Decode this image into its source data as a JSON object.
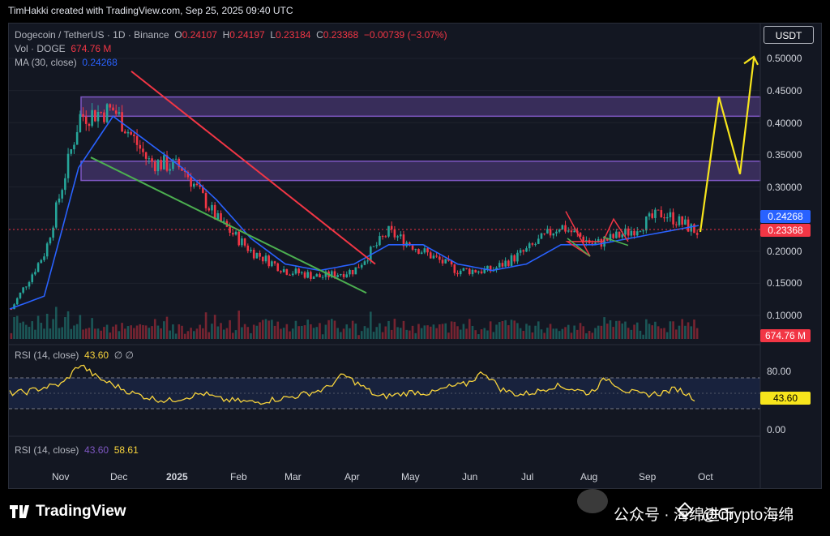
{
  "credit": "TimHakki created with TradingView.com, Sep 25, 2025 09:40 UTC",
  "legend": {
    "symbol": "Dogecoin / TetherUS · 1D · Binance",
    "open_label": "O",
    "open": "0.24107",
    "high_label": "H",
    "high": "0.24197",
    "low_label": "L",
    "low": "0.23184",
    "close_label": "C",
    "close": "0.23368",
    "change": "−0.00739 (−3.07%)",
    "vol_label": "Vol · DOGE",
    "vol": "674.76 M",
    "ma_label": "MA (30, close)",
    "ma": "0.24268",
    "rsi1_label": "RSI (14, close)",
    "rsi1": "43.60",
    "rsi1_extra": "∅  ∅",
    "rsi2_label": "RSI (14, close)",
    "rsi2_a": "43.60",
    "rsi2_b": "58.61"
  },
  "currency": "USDT",
  "price_axis": [
    "0.50000",
    "0.45000",
    "0.40000",
    "0.35000",
    "0.30000",
    "0.20000",
    "0.15000",
    "0.10000"
  ],
  "rsi_axis": [
    "80.00",
    "0.00"
  ],
  "tags": {
    "ma": "0.24268",
    "close": "0.23368",
    "volume": "674.76 M",
    "rsi": "43.60"
  },
  "x_axis": [
    "Nov",
    "Dec",
    "2025",
    "Feb",
    "Mar",
    "Apr",
    "May",
    "Jun",
    "Jul",
    "Aug",
    "Sep",
    "Oct"
  ],
  "brand": "TradingView",
  "watermark": {
    "wechat": "公众号 · 海绵进币",
    "handle": "@Crypto海绵"
  },
  "colors": {
    "up": "#26a69a",
    "down": "#f23645",
    "ma": "#2962ff",
    "rsi": "#f7d33c",
    "zone": "#7e57c2",
    "projection": "#f7e51c",
    "support": "#4caf50"
  },
  "chart_data": {
    "type": "line",
    "title": "Dogecoin / TetherUS · 1D · Binance",
    "ylim": [
      0.1,
      0.5
    ],
    "x": [
      "Nov",
      "Dec",
      "2025",
      "Feb",
      "Mar",
      "Apr",
      "May",
      "Jun",
      "Jul",
      "Aug",
      "Sep",
      "Oct"
    ],
    "series": [
      {
        "name": "Dogecoin / TetherUS",
        "values": [
          0.11,
          0.2,
          0.41,
          0.42,
          0.34,
          0.33,
          0.25,
          0.2,
          0.17,
          0.16,
          0.17,
          0.23,
          0.2,
          0.17,
          0.17,
          0.2,
          0.24,
          0.21,
          0.23,
          0.26,
          0.23
        ]
      },
      {
        "name": "MA (30, close)",
        "values": [
          0.11,
          0.13,
          0.33,
          0.41,
          0.37,
          0.33,
          0.28,
          0.22,
          0.18,
          0.17,
          0.18,
          0.21,
          0.21,
          0.18,
          0.17,
          0.18,
          0.21,
          0.21,
          0.22,
          0.23,
          0.24
        ]
      }
    ],
    "zones": [
      [
        0.41,
        0.44
      ],
      [
        0.31,
        0.34
      ]
    ],
    "projection": [
      0.23,
      0.44,
      0.32,
      0.5
    ],
    "rsi": {
      "name": "RSI (14, close)",
      "last": 43.6,
      "levels": [
        70,
        30
      ],
      "values": [
        50,
        52,
        58,
        62,
        88,
        70,
        60,
        50,
        44,
        40,
        45,
        50,
        42,
        40,
        38,
        42,
        45,
        50,
        56,
        74,
        60,
        45,
        48,
        52,
        50,
        58,
        62,
        78,
        55,
        48,
        52,
        60,
        56,
        50,
        70,
        54,
        48,
        50,
        56,
        43.6
      ]
    },
    "volume_last": "674.76 M"
  }
}
